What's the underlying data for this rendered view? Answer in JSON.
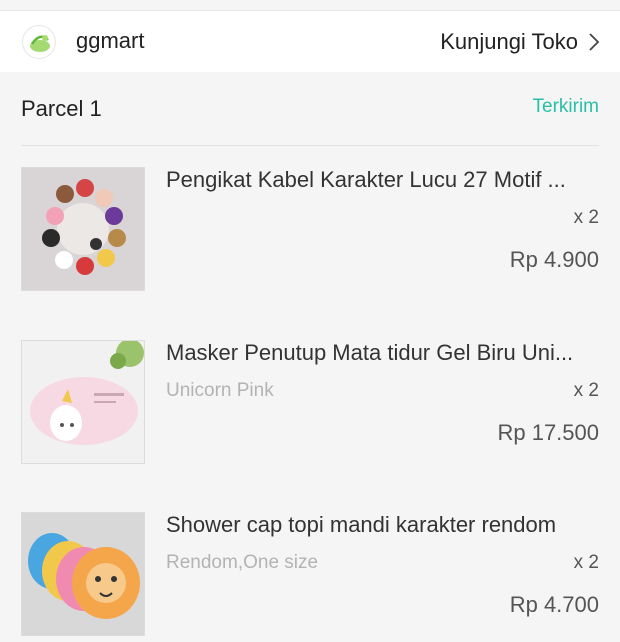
{
  "shop": {
    "name": "ggmart",
    "visit_label": "Kunjungi Toko",
    "logo_icon": "shop-logo-icon",
    "chevron_icon": "chevron-right-icon"
  },
  "parcel": {
    "title": "Parcel 1",
    "status": "Terkirim",
    "status_color": "#27bfa9"
  },
  "items": [
    {
      "name": "Pengikat Kabel Karakter Lucu 27 Motif ...",
      "variant": "",
      "quantity": "x 2",
      "price": "Rp 4.900"
    },
    {
      "name": "Masker Penutup Mata tidur Gel Biru Uni...",
      "variant": "Unicorn Pink",
      "quantity": "x 2",
      "price": "Rp 17.500"
    },
    {
      "name": "Shower cap topi mandi karakter rendom",
      "variant": "Rendom,One size",
      "quantity": "x 2",
      "price": "Rp 4.700"
    }
  ]
}
